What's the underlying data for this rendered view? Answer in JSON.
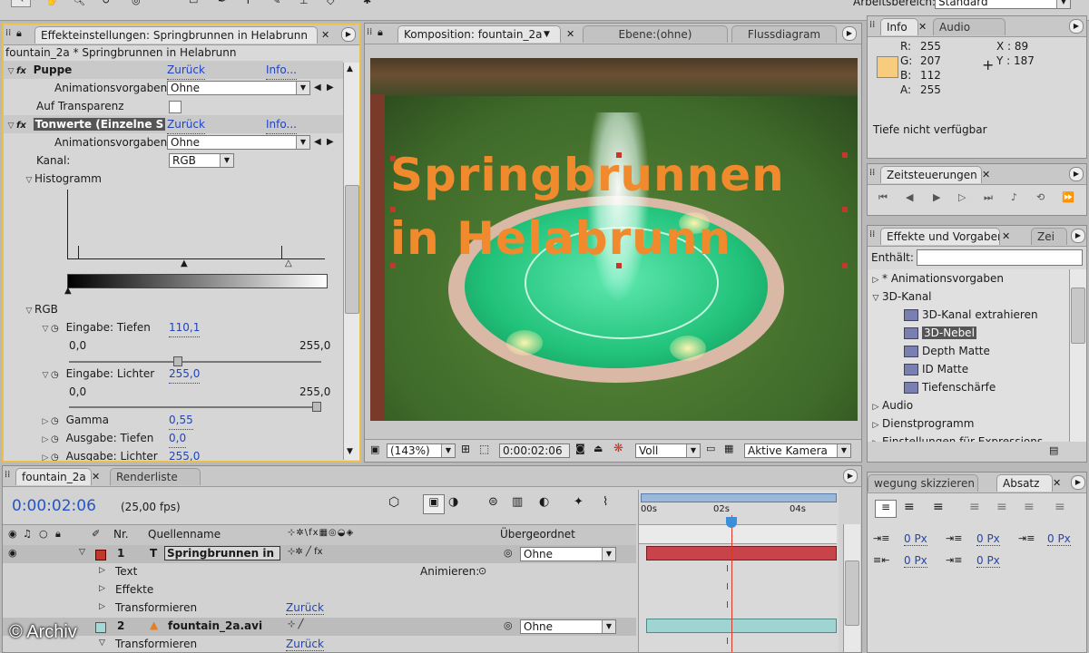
{
  "top": {
    "workspace_label": "Arbeitsbereich:",
    "workspace_value": "Standard"
  },
  "effects_panel": {
    "tab": "Effekteinstellungen: Springbrunnen  in Helabrunn",
    "subtitle": "fountain_2a * Springbrunnen  in Helabrunn",
    "puppe_label": "Puppe",
    "zurueck": "Zurück",
    "info": "Info...",
    "anim_label": "Animationsvorgaben:",
    "anim_value": "Ohne",
    "transparenz_label": "Auf Transparenz",
    "tonwerte_label": "Tonwerte (Einzelne S",
    "kanal_label": "Kanal:",
    "kanal_value": "RGB",
    "histogramm_label": "Histogramm",
    "rgb_label": "RGB",
    "eingabe_tiefen_label": "Eingabe: Tiefen",
    "eingabe_tiefen_value": "110,1",
    "range_min": "0,0",
    "range_max": "255,0",
    "eingabe_lichter_label": "Eingabe: Lichter",
    "eingabe_lichter_value": "255,0",
    "gamma_label": "Gamma",
    "gamma_value": "0,55",
    "ausgabe_tiefen_label": "Ausgabe: Tiefen",
    "ausgabe_tiefen_value": "0,0",
    "ausgabe_lichter_label": "Ausgabe: Lichter",
    "ausgabe_lichter_value": "255,0",
    "slider_tiefen": 0.43,
    "slider_lichter": 1.0
  },
  "comp_panel": {
    "tab": "Komposition: fountain_2a",
    "tab_ebene": "Ebene:(ohne)",
    "tab_fluss": "Flussdiagram",
    "title_line1": "Springbrunnen",
    "title_line2": "in Helabrunn",
    "zoom": "(143%)",
    "timecode": "0:00:02:06",
    "quality": "Voll",
    "camera": "Aktive Kamera"
  },
  "info_panel": {
    "tab_info": "Info",
    "tab_audio": "Audio",
    "r_label": "R:",
    "r": "255",
    "g_label": "G:",
    "g": "207",
    "b_label": "B:",
    "b": "112",
    "a_label": "A:",
    "a": "255",
    "x_label": "X : 89",
    "y_label": "Y : 187",
    "swatch": "#f7cc7c",
    "depth": "Tiefe nicht verfügbar"
  },
  "zeit_panel": {
    "tab": "Zeitsteuerungen"
  },
  "fx_presets": {
    "tab": "Effekte und Vorgaben",
    "tab2": "Zei",
    "enthaelt_label": "Enthält:",
    "items": [
      {
        "label": "* Animationsvorgaben",
        "level": 0,
        "tri": "▷"
      },
      {
        "label": "3D-Kanal",
        "level": 0,
        "tri": "▽"
      },
      {
        "label": "3D-Kanal extrahieren",
        "level": 1,
        "tri": ""
      },
      {
        "label": "3D-Nebel",
        "level": 1,
        "tri": "",
        "selected": true
      },
      {
        "label": "Depth Matte",
        "level": 1,
        "tri": ""
      },
      {
        "label": "ID Matte",
        "level": 1,
        "tri": ""
      },
      {
        "label": "Tiefenschärfe",
        "level": 1,
        "tri": ""
      },
      {
        "label": "Audio",
        "level": 0,
        "tri": "▷"
      },
      {
        "label": "Dienstprogramm",
        "level": 0,
        "tri": "▷"
      },
      {
        "label": "Einstellungen für Expressions",
        "level": 0,
        "tri": "▷"
      }
    ]
  },
  "timeline": {
    "tab1": "fountain_2a",
    "tab2": "Renderliste",
    "timecode": "0:00:02:06",
    "fps": "(25,00 fps)",
    "col_nr": "Nr.",
    "col_source": "Quellenname",
    "col_parent": "Übergeordnet",
    "ruler_0": "00s",
    "ruler_2": "02s",
    "ruler_4": "04s",
    "layer1_nr": "1",
    "layer1_name": "Springbrunnen  in",
    "layer1_parent": "Ohne",
    "text_label": "Text",
    "animieren_label": "Animieren:",
    "effekte_label": "Effekte",
    "transformieren_label": "Transformieren",
    "zurueck": "Zurück",
    "layer2_nr": "2",
    "layer2_name": "fountain_2a.avi",
    "layer2_parent": "Ohne",
    "transformieren2_label": "Transformieren",
    "playhead": 0.47
  },
  "absatz_panel": {
    "tab1": "wegung skizzieren",
    "tab2": "Absatz",
    "px1": "0 Px",
    "px2": "0 Px",
    "px3": "0 Px",
    "px4": "0 Px",
    "px5": "0 Px"
  },
  "watermark": "© Archiv"
}
